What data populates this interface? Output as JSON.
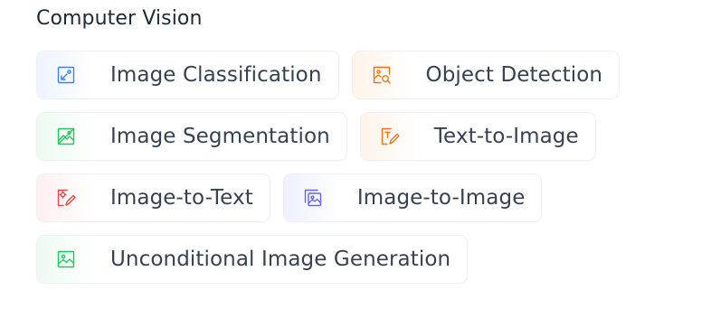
{
  "section": {
    "title": "Computer Vision"
  },
  "colors": {
    "blue": "#3b82f6",
    "orange": "#f97316",
    "green": "#22c55e",
    "red": "#ef4444",
    "indigo": "#6366f1"
  },
  "tasks": [
    {
      "label": "Image Classification",
      "icon": "image-classification-icon",
      "color": "blue"
    },
    {
      "label": "Object Detection",
      "icon": "object-detection-icon",
      "color": "orange"
    },
    {
      "label": "Image Segmentation",
      "icon": "image-segmentation-icon",
      "color": "green"
    },
    {
      "label": "Text-to-Image",
      "icon": "text-to-image-icon",
      "color": "orange"
    },
    {
      "label": "Image-to-Text",
      "icon": "image-to-text-icon",
      "color": "red"
    },
    {
      "label": "Image-to-Image",
      "icon": "image-to-image-icon",
      "color": "indigo"
    },
    {
      "label": "Unconditional Image Generation",
      "icon": "unconditional-image-generation-icon",
      "color": "green"
    }
  ]
}
